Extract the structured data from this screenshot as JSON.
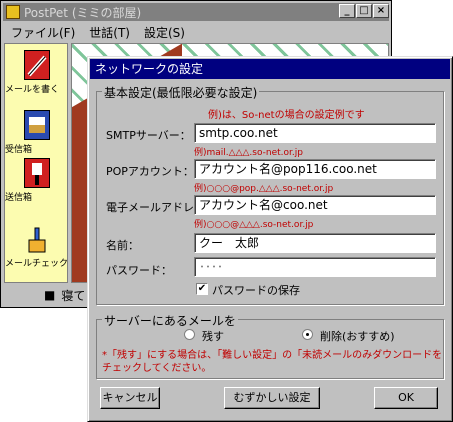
{
  "main_window": {
    "title": "PostPet (ミミの部屋)",
    "controls": [
      "_",
      "□",
      "×"
    ],
    "menu": [
      "ファイル(F)",
      "世話(T)",
      "設定(S)"
    ],
    "toolbar": [
      {
        "label": "メールを書く",
        "icon": "pencil-icon"
      },
      {
        "label": "受信箱",
        "icon": "inbox-icon"
      },
      {
        "label": "送信箱",
        "icon": "outbox-icon"
      },
      {
        "label": "メールチェック",
        "icon": "mail-check-icon"
      }
    ],
    "status_text": "寝て"
  },
  "dialog": {
    "title": "ネットワークの設定",
    "basic_group": "基本設定(最低限必要な設定)",
    "example_note": "例)は、So-netの場合の設定例です",
    "smtp": {
      "label": "SMTPサーバー：",
      "value": "smtp.coo.net",
      "example": "例)mail.△△△.so-net.or.jp"
    },
    "pop": {
      "label": "POPアカウント：",
      "value": "アカウント名@pop116.coo.net",
      "example": "例)○○○@pop.△△△.so-net.or.jp"
    },
    "email": {
      "label": "電子メールアドレス：",
      "value": "アカウント名@coo.net",
      "example": "例)○○○@△△△.so-net.or.jp"
    },
    "name": {
      "label": "名前：",
      "value": "クー　太郎"
    },
    "password": {
      "label": "パスワード：",
      "value": "････"
    },
    "save_password": "パスワードの保存",
    "server_group": "サーバーにあるメールを",
    "radio_keep": "残す",
    "radio_delete": "削除(おすすめ)",
    "note_line1": "*「残す」にする場合は、「難しい設定」の「未読メールのみダウンロードを",
    "note_line2": "チェックしてください。",
    "cancel_button": "キャンセル",
    "advanced_button": "むずかしい設定",
    "ok_button": "OK"
  },
  "colors": {
    "title_active": "#000080",
    "example_red": "#c00000",
    "face": "#c0c0c0"
  }
}
